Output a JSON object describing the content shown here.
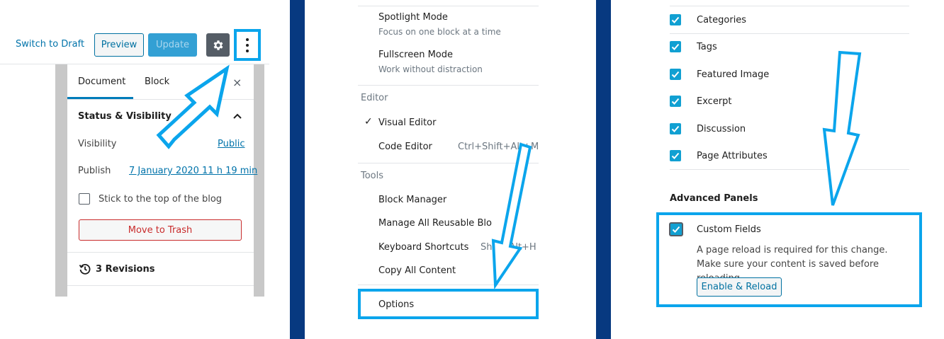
{
  "colors": {
    "accent": "#0ba5ec",
    "link": "#0073aa",
    "divider": "#073980",
    "checkbox": "#11a0d2",
    "danger": "#c92c2c"
  },
  "editor": {
    "switch_to_draft": "Switch to Draft",
    "preview": "Preview",
    "update": "Update",
    "settings_icon": "gear-icon",
    "more_icon": "vertical-ellipsis-icon"
  },
  "sidebar": {
    "tab_document": "Document",
    "tab_block": "Block",
    "close": "×",
    "section_title": "Status & Visibility",
    "visibility_label": "Visibility",
    "visibility_value": "Public",
    "publish_label": "Publish",
    "publish_value": "7 January 2020 11 h 19 min",
    "sticky_label": "Stick to the top of the blog",
    "sticky_checked": false,
    "trash": "Move to Trash",
    "revisions": "3 Revisions"
  },
  "menu": {
    "spotlight": {
      "title": "Spotlight Mode",
      "desc": "Focus on one block at a time"
    },
    "fullscreen": {
      "title": "Fullscreen Mode",
      "desc": "Work without distraction"
    },
    "editor_group": "Editor",
    "visual_editor": "Visual Editor",
    "code_editor": "Code Editor",
    "code_shortcut": "Ctrl+Shift+Alt+M",
    "tools_group": "Tools",
    "block_manager": "Block Manager",
    "manage_reusable": "Manage All Reusable Blocks",
    "keyboard_shortcuts": "Keyboard Shortcuts",
    "keyboard_shortcut": "Shift+Alt+H",
    "copy_all": "Copy All Content",
    "options": "Options",
    "check": "✓"
  },
  "options": {
    "items": [
      "Categories",
      "Tags",
      "Featured Image",
      "Excerpt",
      "Discussion",
      "Page Attributes"
    ],
    "advanced_title": "Advanced Panels",
    "custom_fields": "Custom Fields",
    "custom_fields_checked": true,
    "reload_note": "A page reload is required for this change. Make sure your content is saved before reloading.",
    "enable_reload": "Enable & Reload"
  }
}
